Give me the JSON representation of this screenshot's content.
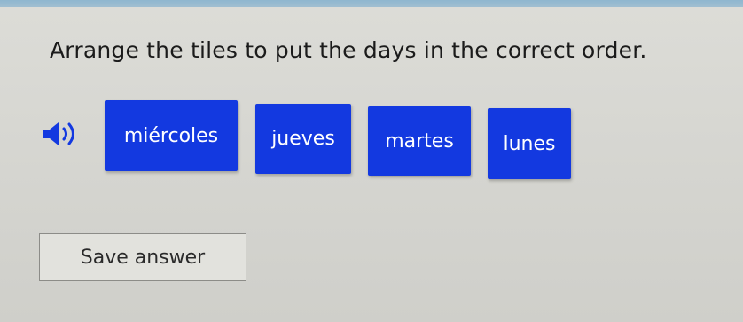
{
  "instruction": "Arrange the tiles to put the days in the correct order.",
  "audio_icon": "speaker-icon",
  "tiles": [
    {
      "label": "miércoles"
    },
    {
      "label": "jueves"
    },
    {
      "label": "martes"
    },
    {
      "label": "lunes"
    }
  ],
  "save_button_label": "Save answer",
  "colors": {
    "tile_background": "#1339e0",
    "tile_text": "#ffffff",
    "page_background": "#d6d6d1"
  }
}
